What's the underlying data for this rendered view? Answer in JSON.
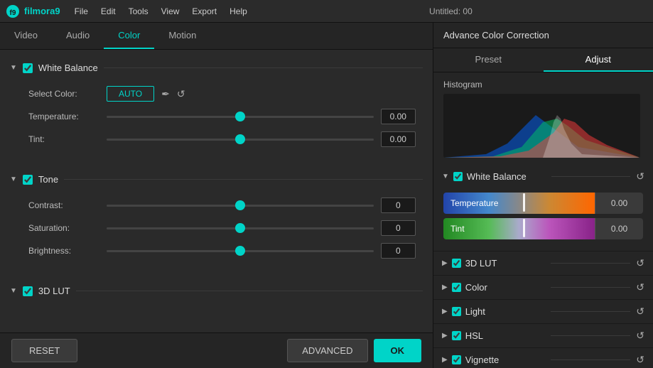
{
  "app": {
    "name": "filmora9",
    "title": "Untitled: 00",
    "advanced_color_title": "Advance Color Correction"
  },
  "menu": {
    "items": [
      "File",
      "Edit",
      "Tools",
      "View",
      "Export",
      "Help"
    ]
  },
  "tabs": {
    "items": [
      "Video",
      "Audio",
      "Color",
      "Motion"
    ],
    "active": "Color"
  },
  "sections": {
    "white_balance": {
      "title": "White Balance",
      "enabled": true,
      "select_color_label": "Select Color:",
      "auto_btn": "AUTO",
      "temperature_label": "Temperature:",
      "temperature_value": "0.00",
      "tint_label": "Tint:",
      "tint_value": "0.00"
    },
    "tone": {
      "title": "Tone",
      "enabled": true,
      "contrast_label": "Contrast:",
      "contrast_value": "0",
      "saturation_label": "Saturation:",
      "saturation_value": "0",
      "brightness_label": "Brightness:",
      "brightness_value": "0"
    },
    "lut_3d": {
      "title": "3D LUT",
      "enabled": true
    }
  },
  "bottom_bar": {
    "reset": "RESET",
    "advanced": "ADVANCED",
    "ok": "OK"
  },
  "right_panel": {
    "title": "Advance Color Correction",
    "tabs": [
      "Preset",
      "Adjust"
    ],
    "active_tab": "Adjust",
    "histogram_label": "Histogram",
    "white_balance": {
      "title": "White Balance",
      "enabled": true,
      "temperature_label": "Temperature",
      "temperature_value": "0.00",
      "tint_label": "Tint",
      "tint_value": "0.00"
    },
    "sections": [
      {
        "title": "3D LUT",
        "enabled": true
      },
      {
        "title": "Color",
        "enabled": true
      },
      {
        "title": "Light",
        "enabled": true
      },
      {
        "title": "HSL",
        "enabled": true
      },
      {
        "title": "Vignette",
        "enabled": true
      }
    ]
  }
}
